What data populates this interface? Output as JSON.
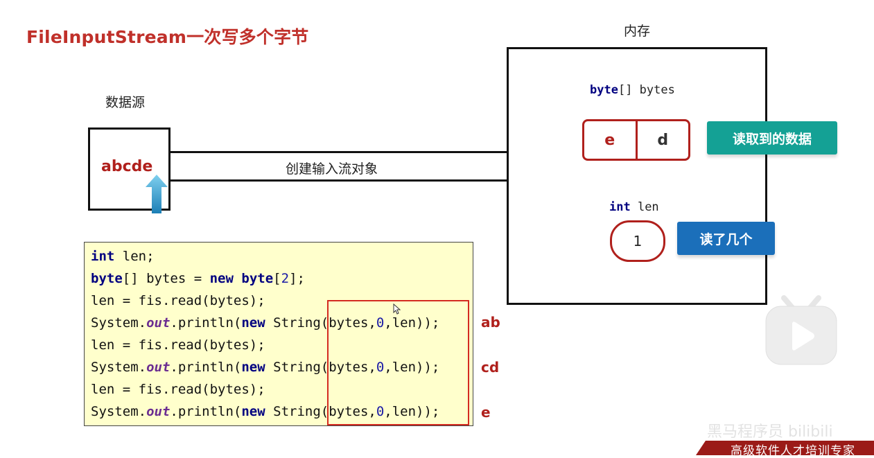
{
  "slide": {
    "title": "FileInputStream一次写多个字节",
    "data_source_label": "数据源",
    "data_source_text": "abcde",
    "stream_label": "创建输入流对象",
    "memory_label": "内存",
    "bytes_decl": {
      "keyword": "byte",
      "rest": "[] bytes"
    },
    "byte_cells": [
      "e",
      "d"
    ],
    "read_data_button": "读取到的数据",
    "len_decl": {
      "keyword": "int",
      "rest": " len"
    },
    "len_value": "1",
    "count_button": "读了几个"
  },
  "code": {
    "lines": [
      {
        "parts": [
          {
            "t": "int",
            "c": "kw"
          },
          {
            "t": " len;",
            "c": ""
          }
        ]
      },
      {
        "parts": [
          {
            "t": "byte",
            "c": "kw"
          },
          {
            "t": "[] bytes = ",
            "c": ""
          },
          {
            "t": "new",
            "c": "kw"
          },
          {
            "t": " ",
            "c": ""
          },
          {
            "t": "byte",
            "c": "kw"
          },
          {
            "t": "[",
            "c": ""
          },
          {
            "t": "2",
            "c": "num"
          },
          {
            "t": "];",
            "c": ""
          }
        ]
      },
      {
        "parts": [
          {
            "t": "len = fis.read(bytes);",
            "c": ""
          }
        ]
      },
      {
        "parts": [
          {
            "t": "System.",
            "c": ""
          },
          {
            "t": "out",
            "c": "it"
          },
          {
            "t": ".println(",
            "c": ""
          },
          {
            "t": "new",
            "c": "kw"
          },
          {
            "t": " String(bytes,",
            "c": ""
          },
          {
            "t": "0",
            "c": "num"
          },
          {
            "t": ",len));",
            "c": ""
          }
        ]
      },
      {
        "parts": [
          {
            "t": "len = fis.read(bytes);",
            "c": ""
          }
        ]
      },
      {
        "parts": [
          {
            "t": "System.",
            "c": ""
          },
          {
            "t": "out",
            "c": "it"
          },
          {
            "t": ".println(",
            "c": ""
          },
          {
            "t": "new",
            "c": "kw"
          },
          {
            "t": " String(bytes,",
            "c": ""
          },
          {
            "t": "0",
            "c": "num"
          },
          {
            "t": ",len));",
            "c": ""
          }
        ]
      },
      {
        "parts": [
          {
            "t": "len = fis.read(bytes);",
            "c": ""
          }
        ]
      },
      {
        "parts": [
          {
            "t": "System.",
            "c": ""
          },
          {
            "t": "out",
            "c": "it"
          },
          {
            "t": ".println(",
            "c": ""
          },
          {
            "t": "new",
            "c": "kw"
          },
          {
            "t": " String(bytes,",
            "c": ""
          },
          {
            "t": "0",
            "c": "num"
          },
          {
            "t": ",len));",
            "c": ""
          }
        ]
      }
    ],
    "outputs": [
      "ab",
      "cd",
      "e"
    ]
  },
  "footer": {
    "slogan": "高级软件人才培训专家",
    "watermark": "黑马程序员 bilibili"
  },
  "icons": {
    "pointer": "up-arrow-icon",
    "bilibili": "bilibili-play-icon",
    "cursor": "mouse-cursor-icon"
  },
  "colors": {
    "title_red": "#c0302a",
    "teal_button": "#14a195",
    "blue_button": "#1b6fba",
    "code_bg": "#ffffcc"
  }
}
